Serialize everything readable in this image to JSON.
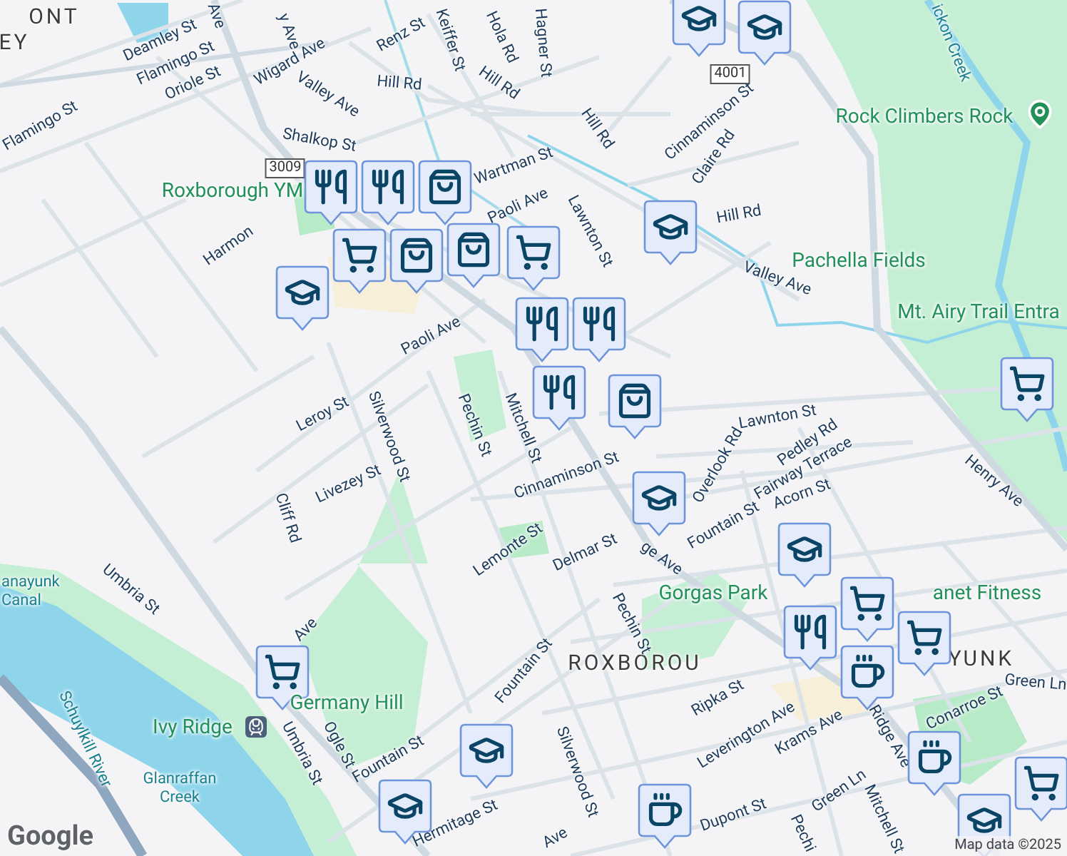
{
  "area_labels": [
    "ONT",
    "EY",
    "ROXBOROU",
    "YUNK"
  ],
  "street_labels": [
    "Ave",
    "y Ave",
    "Deamley St",
    "Flamingo St",
    "Oriole St",
    "Flamingo St",
    "Wigard Ave",
    "Valley Ave",
    "Renz St",
    "Keiffer St",
    "Hola Rd",
    "Hill Rd",
    "Hill Rd",
    "Hagner St",
    "Shalkop St",
    "Wartman St",
    "Paoli Ave",
    "Harmon",
    "Paoli Ave",
    "Leroy St",
    "Silverwood St",
    "Pechin St",
    "Mitchell St",
    "Lawnton St",
    "Hill Rd",
    "Cinnaminson St",
    "Claire Rd",
    "Hill Rd",
    "Valley Ave",
    "Lawnton St",
    "Pedley Rd",
    "Fairway Terrace",
    "Overlook Rd",
    "Acorn St",
    "Fountain St",
    "Henry Ave",
    "Cinnaminson St",
    "Delmar St",
    "ge Ave",
    "Lemonte St",
    "Pechin St",
    "Green Ln",
    "Ripka St",
    "Leverington Ave",
    "Krams Ave",
    "Ridge Ave",
    "Conarroe St",
    "Green Ln",
    "Mitchell St",
    "Dupont St",
    "Silverwood St",
    "Fountain St",
    "Hermitage St",
    "Fountain St",
    "Ogle St",
    "Umbria St",
    "Umbria St",
    "Cliff Rd",
    "Livezey St",
    "Ave",
    "Ave",
    "Pechi"
  ],
  "place_labels": [
    "Roxborough YM",
    "Rock Climbers Rock",
    "Pachella Fields",
    "Mt. Airy Trail Entra",
    "Gorgas Park",
    "anet Fitness",
    "Germany Hill",
    "Ivy Ridge"
  ],
  "water_labels": [
    "ickon Creek",
    "anayunk Canal",
    "Schuylkill River",
    "Glanraffan Creek"
  ],
  "route_shields": [
    "3009",
    "4001"
  ],
  "markers": [
    {
      "kind": "school"
    },
    {
      "kind": "school"
    },
    {
      "kind": "restaurant"
    },
    {
      "kind": "restaurant"
    },
    {
      "kind": "grocery"
    },
    {
      "kind": "shopping"
    },
    {
      "kind": "shopping"
    },
    {
      "kind": "grocery"
    },
    {
      "kind": "school"
    },
    {
      "kind": "restaurant"
    },
    {
      "kind": "restaurant"
    },
    {
      "kind": "shopping"
    },
    {
      "kind": "school"
    },
    {
      "kind": "school"
    },
    {
      "kind": "restaurant"
    },
    {
      "kind": "grocery"
    },
    {
      "kind": "cafe"
    },
    {
      "kind": "grocery"
    },
    {
      "kind": "grocery"
    },
    {
      "kind": "school"
    },
    {
      "kind": "school"
    },
    {
      "kind": "cafe"
    },
    {
      "kind": "cafe"
    },
    {
      "kind": "school"
    },
    {
      "kind": "grocery"
    },
    {
      "kind": "shopping"
    },
    {
      "kind": "restaurant"
    },
    {
      "kind": "school"
    },
    {
      "kind": "grocery"
    }
  ],
  "logo": "Google",
  "attribution": "Map data ©2025"
}
